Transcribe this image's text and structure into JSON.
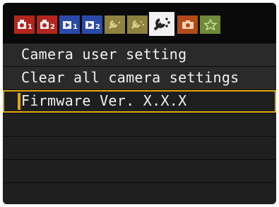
{
  "tabs": [
    {
      "icon": "shooting-menu-1-icon",
      "text": "▸1",
      "color": "#b3261e"
    },
    {
      "icon": "shooting-menu-2-icon",
      "text": "▸2",
      "color": "#b3261e"
    },
    {
      "icon": "playback-menu-1-icon",
      "text": "▸1",
      "color": "#2b4aa8"
    },
    {
      "icon": "playback-menu-2-icon",
      "text": "▸2",
      "color": "#2b4aa8"
    },
    {
      "icon": "setup-menu-1-icon",
      "text": "",
      "color": "#8f8140"
    },
    {
      "icon": "setup-menu-2-icon",
      "text": "",
      "color": "#8f8140"
    },
    {
      "icon": "setup-menu-3-icon",
      "text": "",
      "color": "#f2f2f2",
      "active": true
    },
    {
      "icon": "camera-menu-icon",
      "text": "",
      "color": "#b34a1a"
    },
    {
      "icon": "my-menu-star-icon",
      "text": "",
      "color": "#6e8a3a"
    }
  ],
  "menu": {
    "items": [
      {
        "label": "Camera user setting"
      },
      {
        "label": "Clear all camera settings"
      },
      {
        "label": "Firmware Ver. X.X.X",
        "selected": true
      }
    ],
    "empty_rows": 4
  },
  "colors": {
    "selection": "#e1a70b",
    "row_bg": "#2a2a2a"
  }
}
